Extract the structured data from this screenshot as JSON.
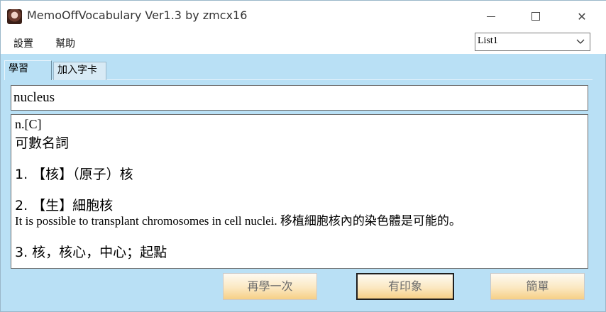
{
  "window": {
    "title": "MemoOffVocabulary Ver1.3 by zmcx16",
    "minimize_glyph": "—",
    "close_glyph": "✕"
  },
  "menu": {
    "settings": "設置",
    "help": "幫助"
  },
  "list_select": {
    "value": "List1"
  },
  "tabs": [
    {
      "label": "學習",
      "active": true
    },
    {
      "label": "加入字卡",
      "active": false
    }
  ],
  "word": "nucleus",
  "definition": {
    "pos": "n.[C]",
    "pos_desc": "可數名詞",
    "sense1": "1. 【核】（原子）核",
    "sense2": "2. 【生】細胞核",
    "example": "It is possible to transplant chromosomes in cell nuclei. 移植細胞核內的染色體是可能的。",
    "sense3": "3. 核，核心，中心；起點"
  },
  "buttons": {
    "again": "再學一次",
    "impression": "有印象",
    "easy": "簡單"
  },
  "colors": {
    "panel_bg": "#b9e0f5",
    "button_gradient_bottom": "#f6cf86"
  }
}
